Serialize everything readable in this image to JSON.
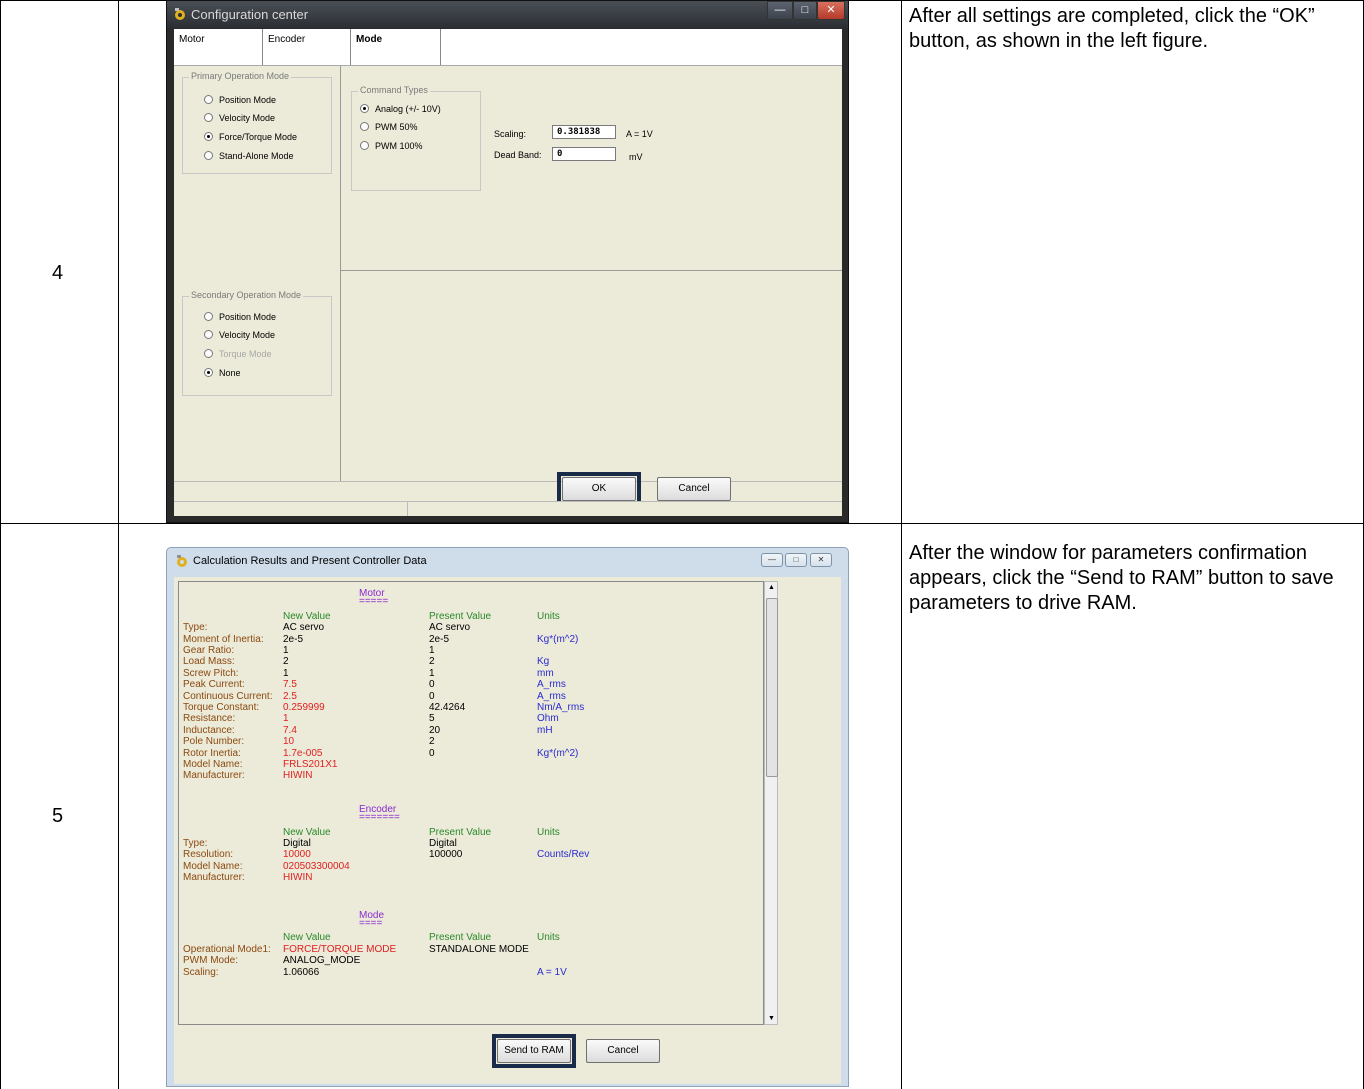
{
  "steps": [
    {
      "number": "4",
      "description": "After all settings are completed, click the “OK” button, as shown in the left figure."
    },
    {
      "number": "5",
      "description": "After the window for parameters confirmation appears, click the “Send to RAM” button to save parameters to drive RAM."
    }
  ],
  "config_window": {
    "title": "Configuration center",
    "tabs": [
      "Motor",
      "Encoder",
      "Mode"
    ],
    "primary_group": "Primary Operation Mode",
    "primary_options": [
      "Position Mode",
      "Velocity Mode",
      "Force/Torque Mode",
      "Stand-Alone Mode"
    ],
    "primary_selected": 2,
    "command_group": "Command Types",
    "command_options": [
      "Analog (+/- 10V)",
      "PWM 50%",
      "PWM 100%"
    ],
    "scaling_label": "Scaling:",
    "scaling_value": "0.381838",
    "scaling_unit": "A = 1V",
    "deadband_label": "Dead Band:",
    "deadband_value": "0",
    "deadband_unit": "mV",
    "secondary_group": "Secondary Operation Mode",
    "secondary_options": [
      "Position Mode",
      "Velocity Mode",
      "Torque Mode",
      "None"
    ],
    "ok_label": "OK",
    "cancel_label": "Cancel"
  },
  "results_window": {
    "title": "Calculation Results and Present Controller Data",
    "headers": {
      "new": "New Value",
      "present": "Present Value",
      "units": "Units"
    },
    "motor_section": "Motor",
    "motor_underline": "=====",
    "motor_rows": [
      {
        "label": "Type:",
        "new": "AC servo",
        "present": "AC servo",
        "unit": ""
      },
      {
        "label": "Moment of Inertia:",
        "new": "2e-5",
        "present": "2e-5",
        "unit": "Kg*(m^2)"
      },
      {
        "label": "Gear Ratio:",
        "new": "1",
        "present": "1",
        "unit": ""
      },
      {
        "label": "Load Mass:",
        "new": "2",
        "present": "2",
        "unit": "Kg"
      },
      {
        "label": "Screw Pitch:",
        "new": "1",
        "present": "1",
        "unit": "mm"
      },
      {
        "label": "Peak Current:",
        "new": "7.5",
        "present": "0",
        "unit": "A_rms"
      },
      {
        "label": "Continuous Current:",
        "new": "2.5",
        "present": "0",
        "unit": "A_rms"
      },
      {
        "label": "Torque Constant:",
        "new": "0.259999",
        "present": "42.4264",
        "unit": "Nm/A_rms"
      },
      {
        "label": "Resistance:",
        "new": "1",
        "present": "5",
        "unit": "Ohm"
      },
      {
        "label": "Inductance:",
        "new": "7.4",
        "present": "20",
        "unit": "mH"
      },
      {
        "label": "Pole Number:",
        "new": "10",
        "present": "2",
        "unit": ""
      },
      {
        "label": "Rotor Inertia:",
        "new": "1.7e-005",
        "present": "0",
        "unit": "Kg*(m^2)"
      },
      {
        "label": "Model Name:",
        "new": "FRLS201X1",
        "present": "",
        "unit": ""
      },
      {
        "label": "Manufacturer:",
        "new": "HIWIN",
        "present": "",
        "unit": ""
      }
    ],
    "encoder_section": "Encoder",
    "encoder_underline": "=======",
    "encoder_rows": [
      {
        "label": "Type:",
        "new": "Digital",
        "present": "Digital",
        "unit": ""
      },
      {
        "label": "Resolution:",
        "new": "10000",
        "present": "100000",
        "unit": "Counts/Rev"
      },
      {
        "label": "Model Name:",
        "new": "020503300004",
        "present": "",
        "unit": ""
      },
      {
        "label": "Manufacturer:",
        "new": "HIWIN",
        "present": "",
        "unit": ""
      }
    ],
    "mode_section": "Mode",
    "mode_underline": "====",
    "mode_rows": [
      {
        "label": "Operational Mode1:",
        "new": "FORCE/TORQUE MODE",
        "present": "STANDALONE MODE",
        "unit": ""
      },
      {
        "label": "PWM Mode:",
        "new": "ANALOG_MODE",
        "present": "",
        "unit": ""
      },
      {
        "label": "Scaling:",
        "new": "1.06066",
        "present": "",
        "unit": "A = 1V"
      }
    ],
    "send_label": "Send to RAM",
    "cancel_label": "Cancel"
  },
  "colors": {
    "highlight_border": "#1a2b4a",
    "label_brown": "#8b4a10",
    "value_red": "#e02020",
    "unit_blue": "#2a2ad0",
    "header_green": "#2a8a2a",
    "section_purple": "#8a2ad0"
  }
}
